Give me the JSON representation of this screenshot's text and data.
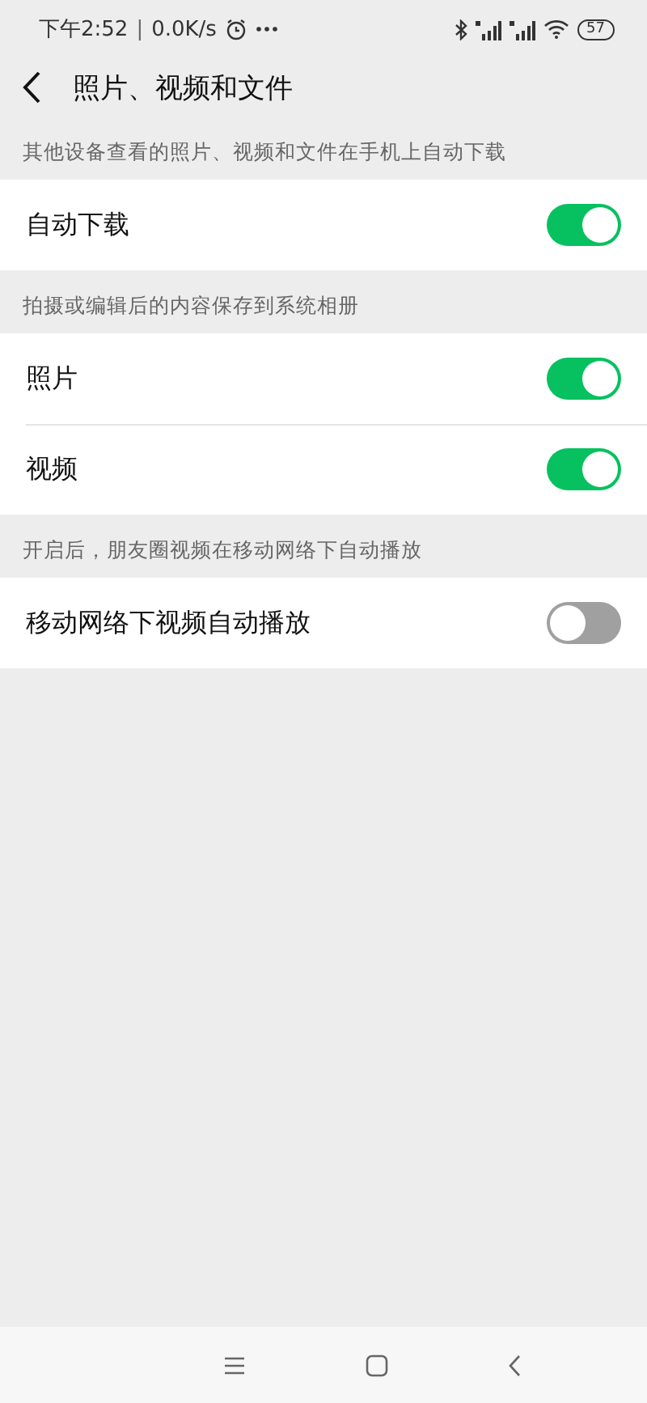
{
  "status_bar": {
    "time": "下午2:52",
    "separator": "|",
    "speed": "0.0K/s",
    "battery": "57"
  },
  "header": {
    "title": "照片、视频和文件"
  },
  "sections": [
    {
      "caption": "其他设备查看的照片、视频和文件在手机上自动下载",
      "rows": [
        {
          "label": "自动下载",
          "on": true
        }
      ]
    },
    {
      "caption": "拍摄或编辑后的内容保存到系统相册",
      "rows": [
        {
          "label": "照片",
          "on": true
        },
        {
          "label": "视频",
          "on": true
        }
      ]
    },
    {
      "caption": "开启后，朋友圈视频在移动网络下自动播放",
      "rows": [
        {
          "label": "移动网络下视频自动播放",
          "on": false
        }
      ]
    }
  ]
}
